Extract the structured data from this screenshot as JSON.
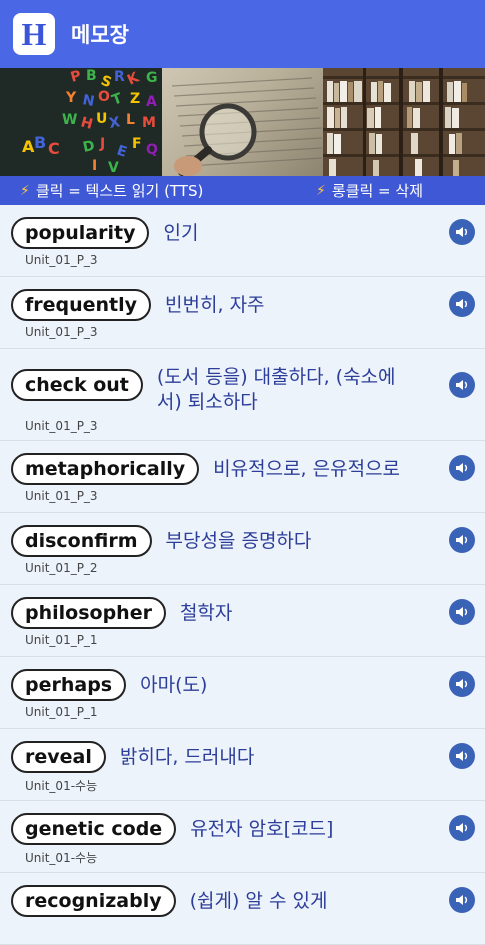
{
  "app": {
    "title": "메모장",
    "icon_letter": "H",
    "accent": "#4a67e6"
  },
  "hints": {
    "click": "클릭 = 텍스트 읽기 (TTS)",
    "long_click": "롱클릭 = 삭제"
  },
  "items": [
    {
      "word": "popularity",
      "meaning": "인기",
      "unit": "Unit_01_P_3"
    },
    {
      "word": "frequently",
      "meaning": "빈번히, 자주",
      "unit": "Unit_01_P_3"
    },
    {
      "word": "check out",
      "meaning": "(도서 등을) 대출하다, (숙소에서) 퇴소하다",
      "unit": "Unit_01_P_3"
    },
    {
      "word": "metaphorically",
      "meaning": "비유적으로, 은유적으로",
      "unit": "Unit_01_P_3"
    },
    {
      "word": "disconfirm",
      "meaning": "부당성을 증명하다",
      "unit": "Unit_01_P_2"
    },
    {
      "word": "philosopher",
      "meaning": "철학자",
      "unit": "Unit_01_P_1"
    },
    {
      "word": "perhaps",
      "meaning": "아마(도)",
      "unit": "Unit_01_P_1"
    },
    {
      "word": "reveal",
      "meaning": "밝히다, 드러내다",
      "unit": "Unit_01-수능"
    },
    {
      "word": "genetic code",
      "meaning": "유전자 암호[코드]",
      "unit": "Unit_01-수능"
    },
    {
      "word": "recognizably",
      "meaning": "(쉽게) 알 수 있게",
      "unit": ""
    }
  ]
}
